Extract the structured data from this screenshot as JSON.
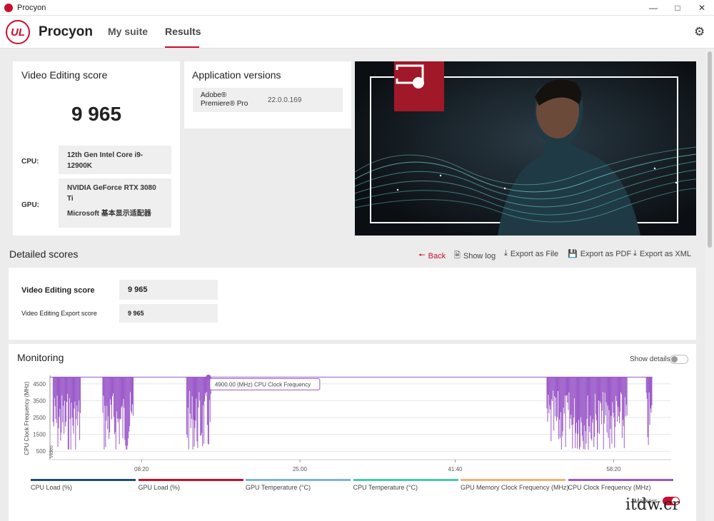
{
  "window": {
    "title": "Procyon"
  },
  "header": {
    "app_name": "Procyon",
    "logo_text": "UL",
    "tabs": [
      {
        "label": "My suite"
      },
      {
        "label": "Results"
      }
    ]
  },
  "score_card": {
    "title": "Video Editing score",
    "score": "9 965",
    "cpu_label": "CPU:",
    "cpu_value": "12th Gen Intel Core i9-12900K",
    "gpu_label": "GPU:",
    "gpu_value_1": "NVIDIA GeForce RTX 3080 Ti",
    "gpu_value_2": "Microsoft 基本显示适配器"
  },
  "app_versions": {
    "title": "Application versions",
    "app_name": "Adobe® Premiere® Pro",
    "version": "22.0.0.169"
  },
  "detailed": {
    "title": "Detailed scores",
    "actions": {
      "back": "Back",
      "show_log": "Show log",
      "export_file": "Export as File",
      "export_pdf": "Export as PDF",
      "export_xml": "Export as XML"
    },
    "rows": [
      {
        "label": "Video Editing score",
        "value": "9 965"
      },
      {
        "label": "Video Editing Export score",
        "value": "9 965"
      }
    ]
  },
  "monitoring": {
    "title": "Monitoring",
    "show_details_label": "Show details",
    "markers_label": "Markers",
    "colors": {
      "cpu_clock": "#9b59c9",
      "accent": "#c8102e"
    },
    "legend": [
      {
        "label": "CPU Load (%)",
        "color": "#1f4e79"
      },
      {
        "label": "GPU Load (%)",
        "color": "#c8102e"
      },
      {
        "label": "GPU Temperature (°C)",
        "color": "#7fb3d5"
      },
      {
        "label": "CPU Temperature (°C)",
        "color": "#48c9b0"
      },
      {
        "label": "GPU Memory Clock Frequency (MHz)",
        "color": "#f0b27a"
      },
      {
        "label": "CPU Clock Frequency (MHz)",
        "color": "#9b59c9"
      }
    ]
  },
  "chart_data": {
    "type": "line",
    "ylabel": "CPU Clock Frequency (MHz)",
    "y_ticks": [
      "4500",
      "3500",
      "2500",
      "1500",
      "500"
    ],
    "x_ticks": [
      "08:20",
      "25:00",
      "41:40",
      "58:20"
    ],
    "tooltip": "4900.00 (MHz) CPU Clock Frequency",
    "series": [
      {
        "name": "CPU Clock Frequency (MHz)",
        "color": "#9b59c9",
        "baseline_mhz": 4900,
        "x_min": [
          0.0,
          4.0,
          29.2,
          55.0,
          66.0
        ],
        "segments": [
          [
            0.5,
            5.0
          ],
          [
            8.5,
            13.5
          ],
          [
            22.0,
            26.0
          ],
          [
            80.0,
            93.0
          ],
          [
            96.0,
            97.0
          ]
        ]
      }
    ],
    "markers": [
      {
        "label": "Video"
      }
    ]
  }
}
